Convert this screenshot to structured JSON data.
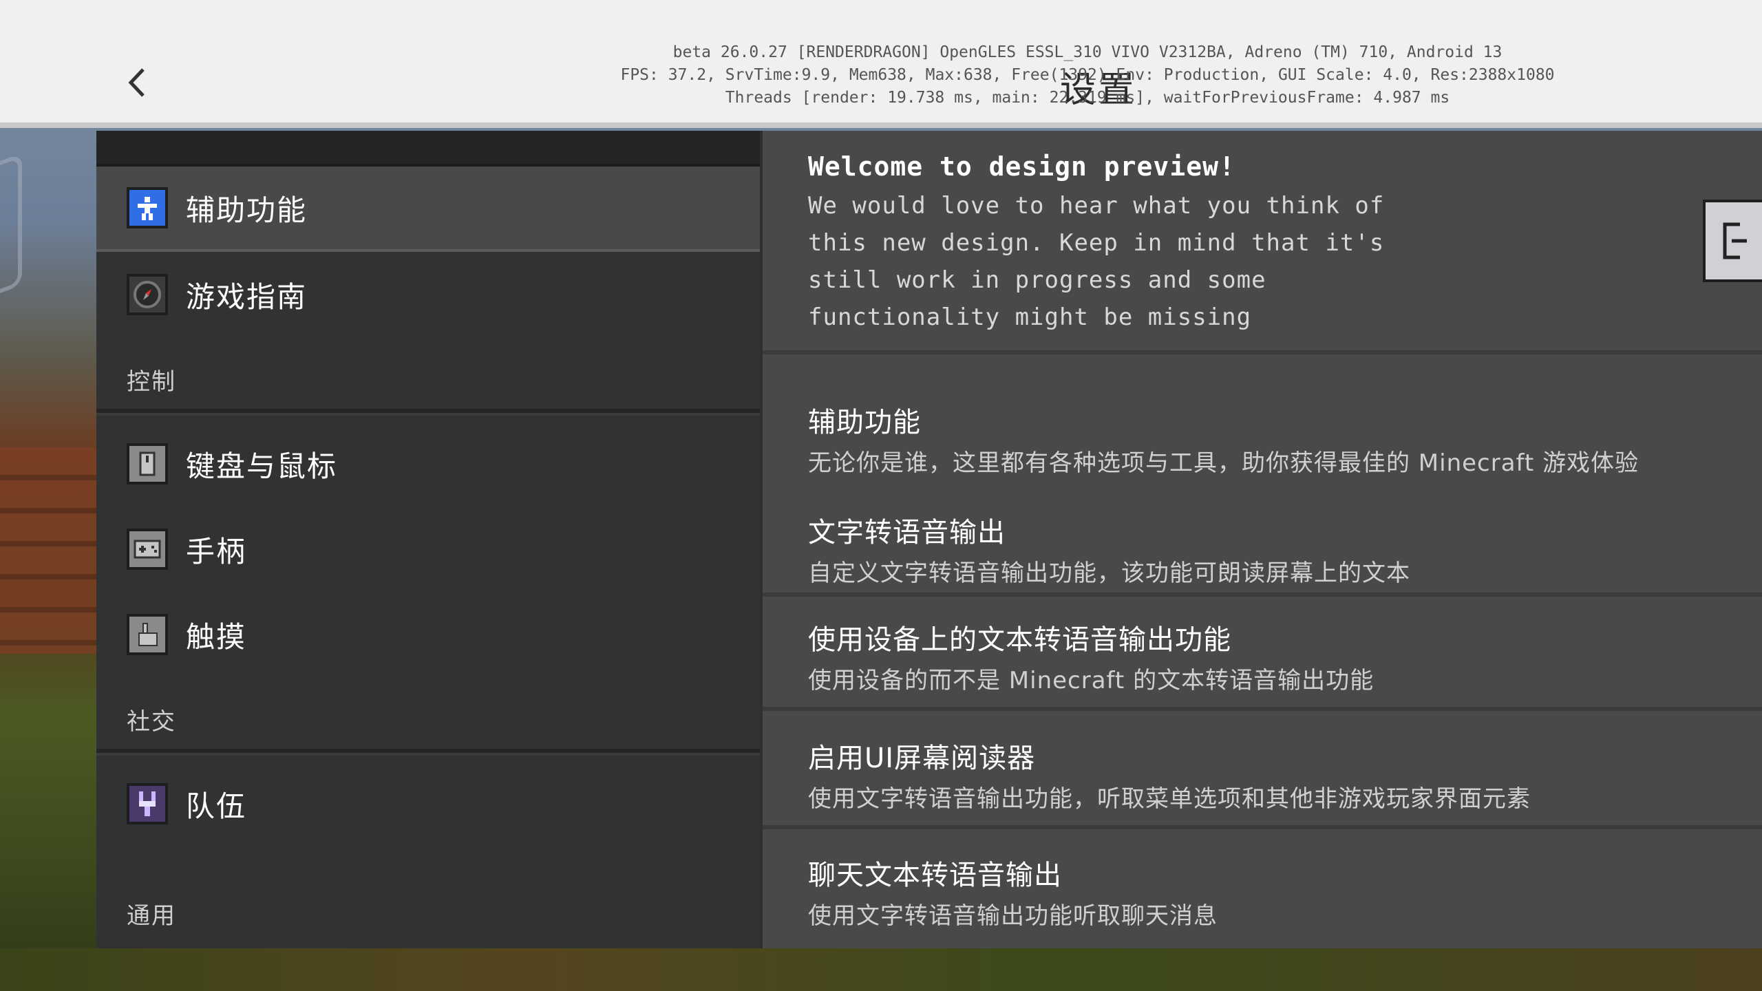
{
  "header": {
    "title": "设置",
    "debug_lines": [
      "beta 26.0.27 [RENDERDRAGON] OpenGLES ESSL_310 VIVO V2312BA, Adreno (TM) 710, Android 13",
      "FPS: 37.2, SrvTime:9.9, Mem638, Max:638, Free(1392) Env: Production, GUI Scale: 4.0, Res:2388x1080",
      "Threads [render: 19.738 ms, main: 22.319 ms], waitForPreviousFrame: 4.987 ms"
    ]
  },
  "sidebar": {
    "items_top": [
      {
        "label": "辅助功能",
        "icon": "accessibility-icon",
        "selected": true
      },
      {
        "label": "游戏指南",
        "icon": "compass-icon",
        "selected": false
      }
    ],
    "section_controls": "控制",
    "items_controls": [
      {
        "label": "键盘与鼠标",
        "icon": "keyboard-icon"
      },
      {
        "label": "手柄",
        "icon": "gamepad-icon"
      },
      {
        "label": "触摸",
        "icon": "touch-icon"
      }
    ],
    "section_social": "社交",
    "items_social": [
      {
        "label": "队伍",
        "icon": "party-icon"
      }
    ],
    "section_general": "通用"
  },
  "welcome": {
    "title": "Welcome to design preview!",
    "body": "We would love to hear what you think of this new design. Keep in mind that it's still work in progress and some functionality might be missing"
  },
  "settings": [
    {
      "title": "辅助功能",
      "desc": "无论你是谁，这里都有各种选项与工具，助你获得最佳的 Minecraft 游戏体验"
    },
    {
      "title": "文字转语音输出",
      "desc": "自定义文字转语音输出功能，该功能可朗读屏幕上的文本"
    },
    {
      "title": "使用设备上的文本转语音输出功能",
      "desc": "使用设备的而不是 Minecraft 的文本转语音输出功能"
    },
    {
      "title": "启用UI屏幕阅读器",
      "desc": "使用文字转语音输出功能，听取菜单选项和其他非游戏玩家界面元素"
    },
    {
      "title": "聊天文本转语音输出",
      "desc": "使用文字转语音输出功能听取聊天消息"
    }
  ]
}
